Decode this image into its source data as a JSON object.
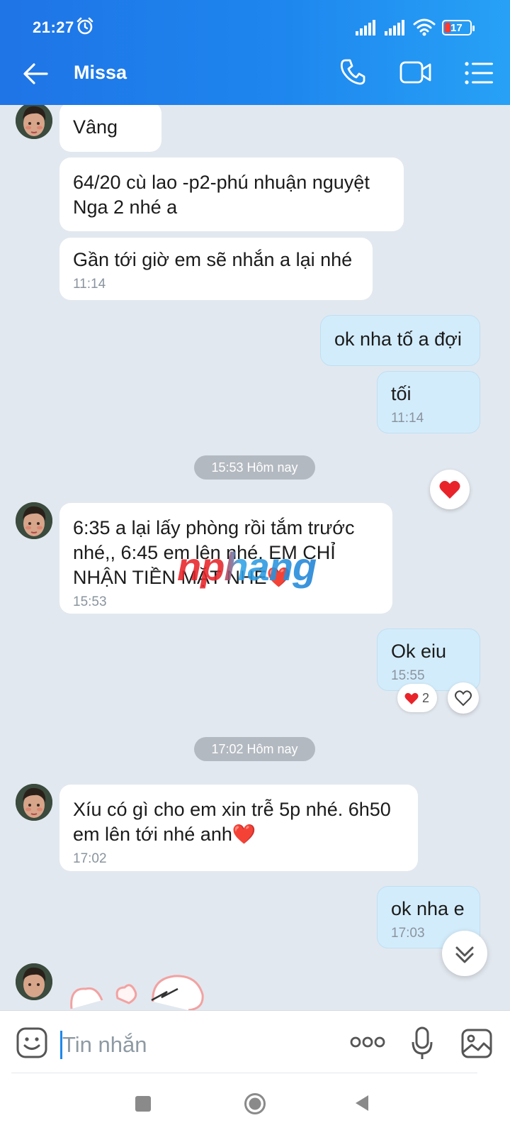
{
  "status_bar": {
    "time": "21:27",
    "battery": "17"
  },
  "header": {
    "contact_name": "Missa"
  },
  "messages": [
    {
      "text": "Vâng"
    },
    {
      "text": "64/20 cù lao -p2-phú nhuận nguyệt Nga 2 nhé a"
    },
    {
      "text": "Gần tới giờ em sẽ nhắn a lại nhé",
      "time": "11:14"
    },
    {
      "text": "ok nha tố a đợi"
    },
    {
      "text": "tối",
      "time": "11:14"
    },
    {
      "text": "6:35  a lại lấy phòng rồi tắm trước nhé,, 6:45  em lên nhé. EM CHỈ NHẬN TIỀN MẶT NHÉ❤️",
      "time": "15:53"
    },
    {
      "text": "Ok eiu",
      "time": "15:55"
    },
    {
      "text": "Xíu có gì cho em xin trễ 5p nhé. 6h50 em lên tới nhé anh❤️",
      "time": "17:02"
    },
    {
      "text": "ok nha e",
      "time": "17:03"
    }
  ],
  "date_separators": [
    "15:53 Hôm nay",
    "17:02 Hôm nay"
  ],
  "reactions": {
    "ok_eiu_count": "2"
  },
  "watermark": "nphang",
  "composer": {
    "placeholder": "Tin nhắn"
  },
  "colors": {
    "header_start": "#1f74e6",
    "header_end": "#27a1f6",
    "incoming_bubble": "#ffffff",
    "outgoing_bubble": "#d3ecfb",
    "heart": "#e8242a"
  }
}
